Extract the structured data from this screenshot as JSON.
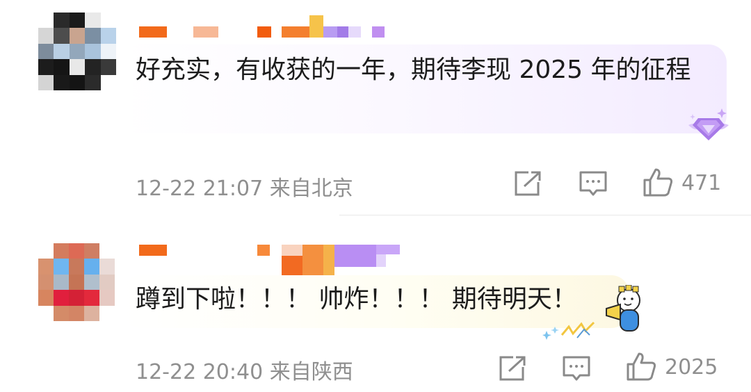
{
  "comments": [
    {
      "text": "好充实，有收获的一年，期待李现 2025 年的征程",
      "time": "12-22 21:07",
      "location": "来自北京",
      "likes": "471",
      "badge_icon": "purple-diamond-badge-icon"
    },
    {
      "text": "蹲到下啦！！！ 帅炸！！！ 期待明天！",
      "time": "12-22 20:40",
      "location": "来自陕西",
      "likes": "2025",
      "badge_icon": "cheering-character-sticker-icon"
    }
  ],
  "icons": {
    "share": "share-icon",
    "reply": "comment-icon",
    "like": "thumbs-up-icon"
  },
  "colors": {
    "meta_text": "#8f8f8f",
    "body_text": "#1c1c1c",
    "bubble1_accent": "#f3ebff",
    "bubble2_accent": "#fdf8e2"
  }
}
